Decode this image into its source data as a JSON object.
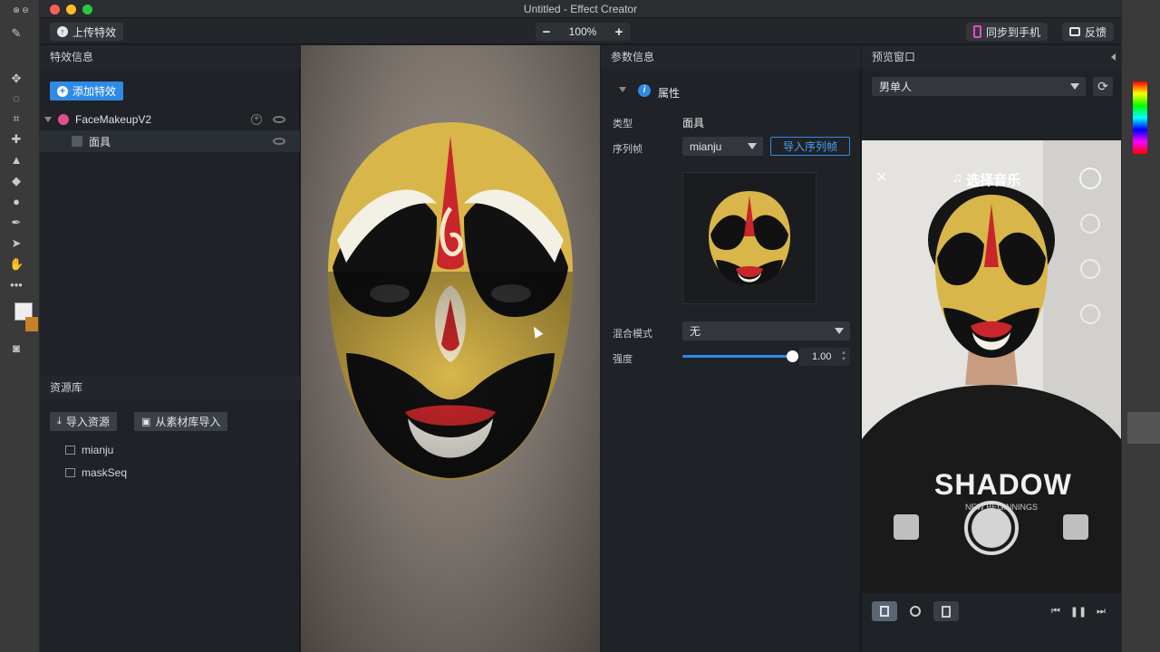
{
  "window": {
    "title": "Untitled - Effect Creator"
  },
  "toolbar": {
    "upload_label": "上传特效",
    "zoom_out": "−",
    "zoom_value": "100%",
    "zoom_in": "+",
    "sync_label": "同步到手机",
    "feedback_label": "反馈"
  },
  "left_panel": {
    "header": "特效信息",
    "add_effect": "添加特效",
    "tree": [
      {
        "label": "FaceMakeupV2"
      },
      {
        "label": "面具"
      }
    ]
  },
  "resources": {
    "header": "资源库",
    "import_label": "导入资源",
    "import_lib_label": "从素材库导入",
    "items": [
      {
        "label": "mianju"
      },
      {
        "label": "maskSeq"
      }
    ]
  },
  "params": {
    "header": "参数信息",
    "section": "属性",
    "type_label": "类型",
    "type_value": "面具",
    "seq_label": "序列帧",
    "seq_value": "mianju",
    "import_seq": "导入序列帧",
    "blend_label": "混合模式",
    "blend_value": "无",
    "strength_label": "强度",
    "strength_value": "1.00",
    "strength_fraction": 1.0
  },
  "preview": {
    "header": "预览窗口",
    "model": "男单人",
    "music_label": "选择音乐",
    "shirt_text": "SHADOW",
    "shirt_sub": "NEW BEGINNINGS"
  },
  "colors": {
    "accent": "#2f8ae6",
    "mask_gold": "#d8b64a",
    "mask_red": "#c8262b"
  }
}
